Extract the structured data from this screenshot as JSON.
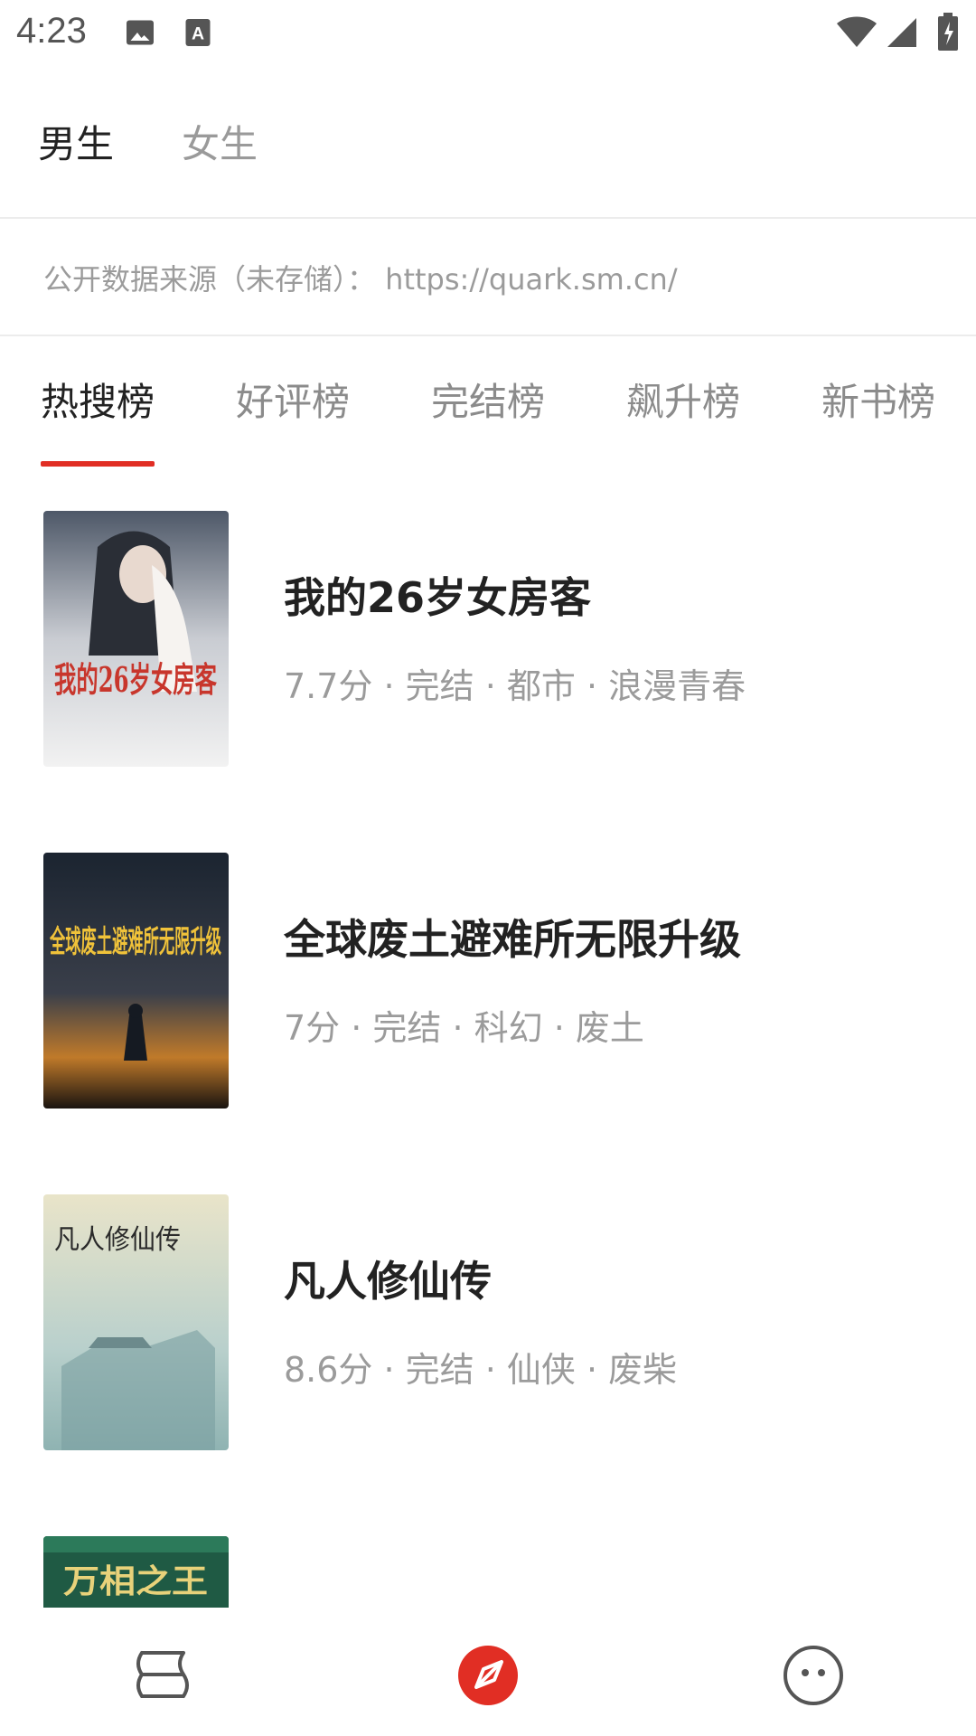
{
  "status_bar": {
    "time": "4:23",
    "icons": [
      "image-icon",
      "font-download-icon",
      "wifi-icon",
      "signal-icon",
      "battery-charging-icon"
    ]
  },
  "gender_tabs": [
    {
      "label": "男生",
      "active": true
    },
    {
      "label": "女生",
      "active": false
    }
  ],
  "source_text": "公开数据来源（未存储）： https://quark.sm.cn/",
  "rank_tabs": [
    {
      "label": "热搜榜",
      "active": true
    },
    {
      "label": "好评榜",
      "active": false
    },
    {
      "label": "完结榜",
      "active": false
    },
    {
      "label": "飙升榜",
      "active": false
    },
    {
      "label": "新书榜",
      "active": false
    }
  ],
  "books": [
    {
      "title": "我的26岁女房客",
      "meta": "7.7分 · 完结 · 都市 · 浪漫青春",
      "cover_text": "我的26岁女房客"
    },
    {
      "title": "全球废土避难所无限升级",
      "meta": "7分 · 完结 · 科幻 · 废土",
      "cover_text": "全球废土避难所无限升级"
    },
    {
      "title": "凡人修仙传",
      "meta": "8.6分 · 完结 · 仙侠 · 废柴",
      "cover_text": "凡人修仙传"
    },
    {
      "title": "",
      "meta": "",
      "cover_text": "万相之王"
    }
  ],
  "bottom_nav": [
    {
      "icon": "bookshelf-icon",
      "active": false
    },
    {
      "icon": "compass-icon",
      "active": true
    },
    {
      "icon": "face-icon",
      "active": false
    }
  ],
  "colors": {
    "accent": "#e12e24",
    "text_primary": "#222222",
    "text_secondary": "#9b9b9b"
  }
}
